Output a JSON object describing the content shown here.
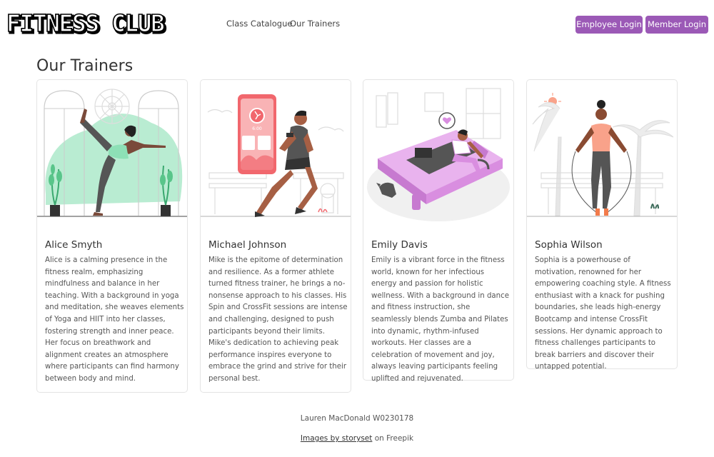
{
  "nav": {
    "logo_text": "FITNESS CLUB",
    "links": [
      "Class Catalogue",
      "Our Trainers"
    ],
    "buttons": [
      "Employee Login",
      "Member Login"
    ]
  },
  "page_title": "Our Trainers",
  "trainers": [
    {
      "name": "Alice Smyth",
      "bio": "Alice is a calming presence in the fitness realm, emphasizing mindfulness and balance in her teaching. With a background in yoga and meditation, she weaves elements of Yoga and HIIT into her classes, fostering strength and inner peace. Her focus on breathwork and alignment creates an atmosphere where participants can find harmony between body and mind.",
      "illustration": "yoga-pose-illustration"
    },
    {
      "name": "Michael Johnson",
      "bio": "Mike is the epitome of determination and resilience. As a former athlete turned fitness trainer, he brings a no-nonsense approach to his classes. His Spin and CrossFit sessions are intense and challenging, designed to push participants beyond their limits. Mike's dedication to achieving peak performance inspires everyone to embrace the grind and strive for their personal best.",
      "illustration": "runner-illustration",
      "phone_time": "6:00"
    },
    {
      "name": "Emily Davis",
      "bio": "Emily is a vibrant force in the fitness world, known for her infectious energy and passion for holistic wellness. With a background in dance and fitness instruction, she seamlessly blends Zumba and Pilates into dynamic, rhythm-infused workouts. Her classes are a celebration of movement and joy, always leaving participants feeling uplifted and rejuvenated.",
      "illustration": "pilates-reformer-illustration"
    },
    {
      "name": "Sophia Wilson",
      "bio": "Sophia is a powerhouse of motivation, renowned for her empowering coaching style. A fitness enthusiast with a knack for pushing boundaries, she leads high-energy Bootcamp and intense CrossFit sessions. Her dynamic approach to fitness challenges participants to break barriers and discover their untapped potential.",
      "illustration": "jump-rope-illustration"
    }
  ],
  "footer": {
    "author": "Lauren MacDonald W0230178",
    "credit_link": "Images by storyset",
    "credit_suffix": " on Freepik"
  },
  "colors": {
    "brand_button": "#9b59b6",
    "yoga_accent": "#8de0b6",
    "runner_accent": "#f1676d",
    "pilates_accent": "#d98ee0",
    "jump_accent": "#f9a28a"
  }
}
